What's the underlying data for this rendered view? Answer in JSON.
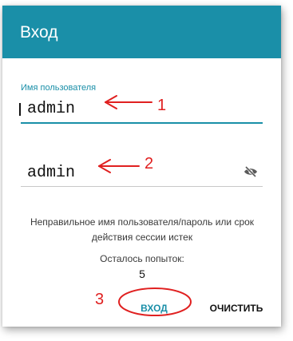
{
  "dialog": {
    "title": "Вход"
  },
  "username": {
    "label": "Имя пользователя",
    "value": "admin"
  },
  "password": {
    "value": "admin",
    "visibility_icon": "eye-off-icon"
  },
  "error": {
    "message": "Неправильное имя пользователя/пароль или срок действия сессии истек",
    "attempts_label": "Осталось попыток:",
    "attempts_count": "5"
  },
  "actions": {
    "login_label": "ВХОД",
    "clear_label": "ОЧИСТИТЬ"
  },
  "annotations": {
    "marker_1": "1",
    "marker_2": "2",
    "marker_3": "3",
    "color": "#e02020"
  },
  "colors": {
    "accent": "#1a8fa8",
    "header_bg": "#1a8fa8"
  }
}
